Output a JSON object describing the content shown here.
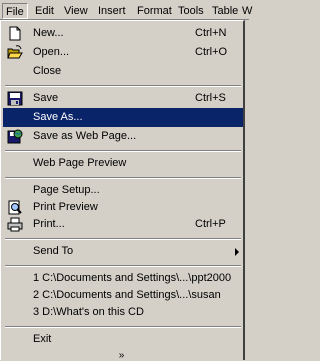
{
  "menubar": {
    "items": [
      "File",
      "Edit",
      "View",
      "Insert",
      "Format",
      "Tools",
      "Table",
      "W"
    ]
  },
  "menu": {
    "new": {
      "label": "New...",
      "shortcut": "Ctrl+N"
    },
    "open": {
      "label": "Open...",
      "shortcut": "Ctrl+O"
    },
    "close": {
      "label": "Close"
    },
    "save": {
      "label": "Save",
      "shortcut": "Ctrl+S"
    },
    "save_as": {
      "label": "Save As..."
    },
    "save_web": {
      "label": "Save as Web Page..."
    },
    "web_preview": {
      "label": "Web Page Preview"
    },
    "page_setup": {
      "label": "Page Setup..."
    },
    "print_preview": {
      "label": "Print Preview"
    },
    "print": {
      "label": "Print...",
      "shortcut": "Ctrl+P"
    },
    "send_to": {
      "label": "Send To"
    },
    "recent": [
      "1 C:\\Documents and Settings\\...\\ppt2000",
      "2 C:\\Documents and Settings\\...\\susan",
      "3 D:\\What's on this CD"
    ],
    "exit": {
      "label": "Exit"
    },
    "more": "»"
  }
}
